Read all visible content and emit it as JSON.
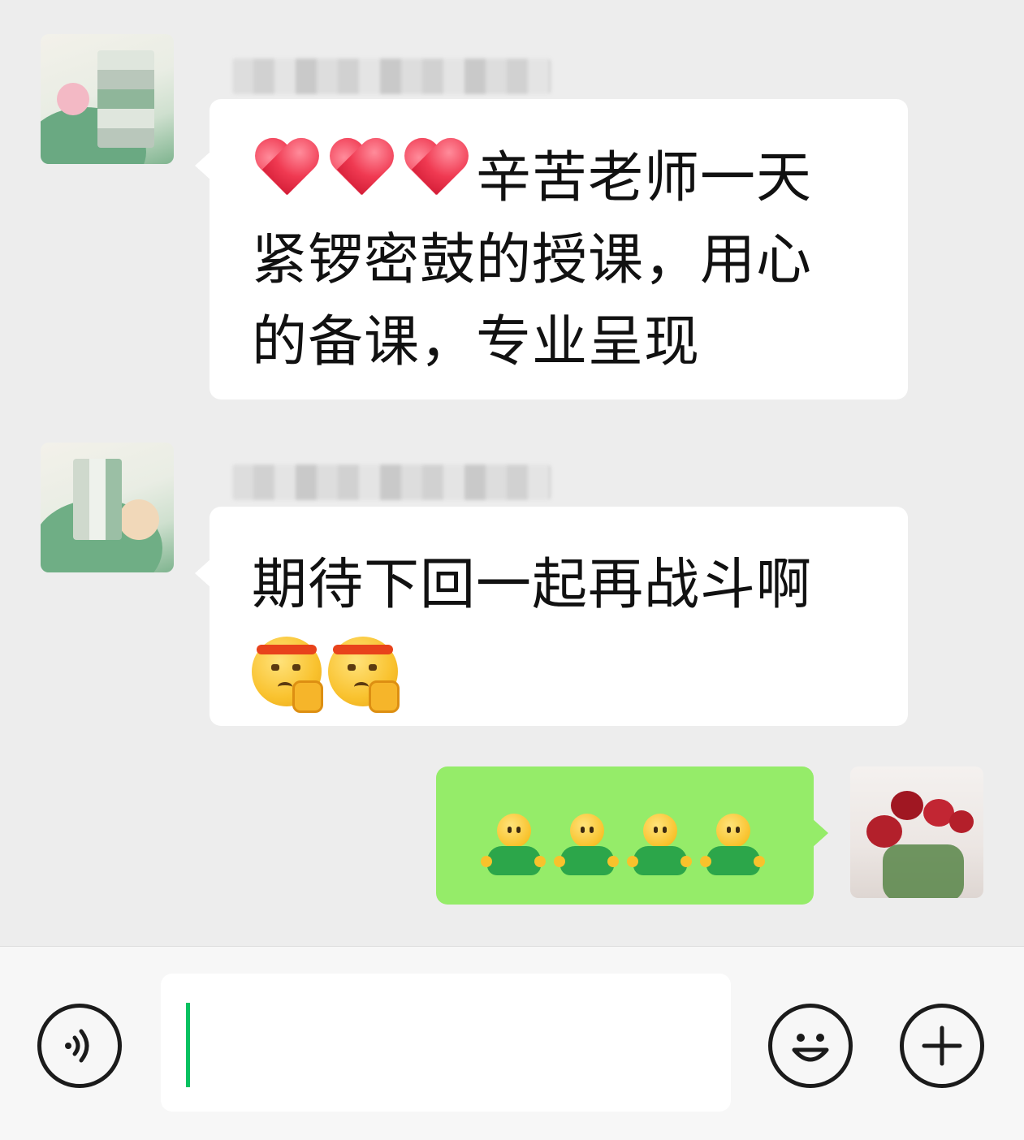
{
  "messages": [
    {
      "direction": "incoming",
      "sender_avatar": "lotus-painting-avatar",
      "line1_text": "辛苦老师一天",
      "line2_text": "紧锣密鼓的授课，用心",
      "line3_text": "的备课，专业呈现",
      "emojis": [
        "heart",
        "heart",
        "heart"
      ]
    },
    {
      "direction": "incoming",
      "sender_avatar": "lotus-painting-avatar",
      "line1_text": "期待下回一起再战斗啊",
      "emojis": [
        "determined-face",
        "determined-face"
      ]
    },
    {
      "direction": "outgoing",
      "sender_avatar": "red-roses-avatar",
      "emojis": [
        "wave-person",
        "wave-person",
        "wave-person",
        "wave-person"
      ]
    }
  ],
  "input_bar": {
    "voice_icon": "voice-icon",
    "emoji_icon": "smiley-icon",
    "more_icon": "plus-icon",
    "text_value": ""
  },
  "colors": {
    "chat_background": "#ededed",
    "incoming_bubble": "#ffffff",
    "outgoing_bubble": "#95ec69",
    "caret": "#07c160"
  }
}
